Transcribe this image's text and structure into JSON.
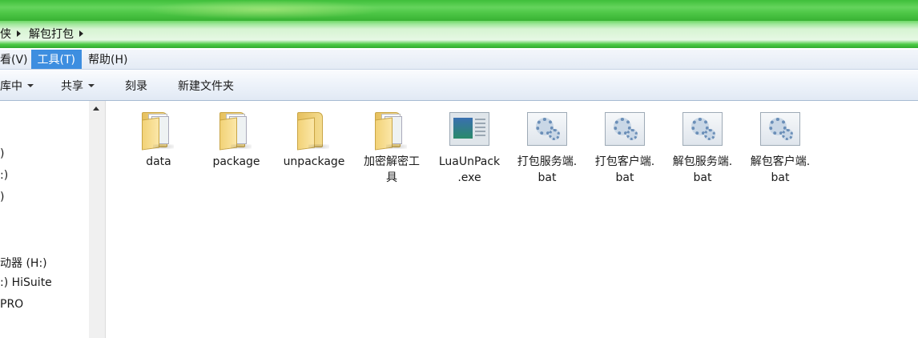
{
  "address": {
    "crumbs": [
      "侠",
      "解包打包"
    ]
  },
  "menu": {
    "items": [
      "看(V)",
      "工具(T)",
      "帮助(H)"
    ],
    "active_index": 1
  },
  "toolbar": {
    "library_label": "库中",
    "share_label": "共享",
    "burn_label": "刻录",
    "new_folder_label": "新建文件夹"
  },
  "nav": {
    "items": [
      ")",
      ":)",
      ")",
      "动器 (H:)",
      ":) HiSuite",
      "PRO"
    ]
  },
  "files": [
    {
      "line1": "data",
      "line2": "",
      "icon": "folder-icon"
    },
    {
      "line1": "package",
      "line2": "",
      "icon": "folder-icon"
    },
    {
      "line1": "unpackage",
      "line2": "",
      "icon": "folder-icon"
    },
    {
      "line1": "加密解密工",
      "line2": "具",
      "icon": "folder-icon"
    },
    {
      "line1": "LuaUnPack",
      "line2": ".exe",
      "icon": "exe-icon"
    },
    {
      "line1": "打包服务端.",
      "line2": "bat",
      "icon": "bat-file-icon"
    },
    {
      "line1": "打包客户端.",
      "line2": "bat",
      "icon": "bat-file-icon"
    },
    {
      "line1": "解包服务端.",
      "line2": "bat",
      "icon": "bat-file-icon"
    },
    {
      "line1": "解包客户端.",
      "line2": "bat",
      "icon": "bat-file-icon"
    }
  ],
  "colors": {
    "titlebar": "#4fc848",
    "menu_active": "#3d8ee0"
  }
}
